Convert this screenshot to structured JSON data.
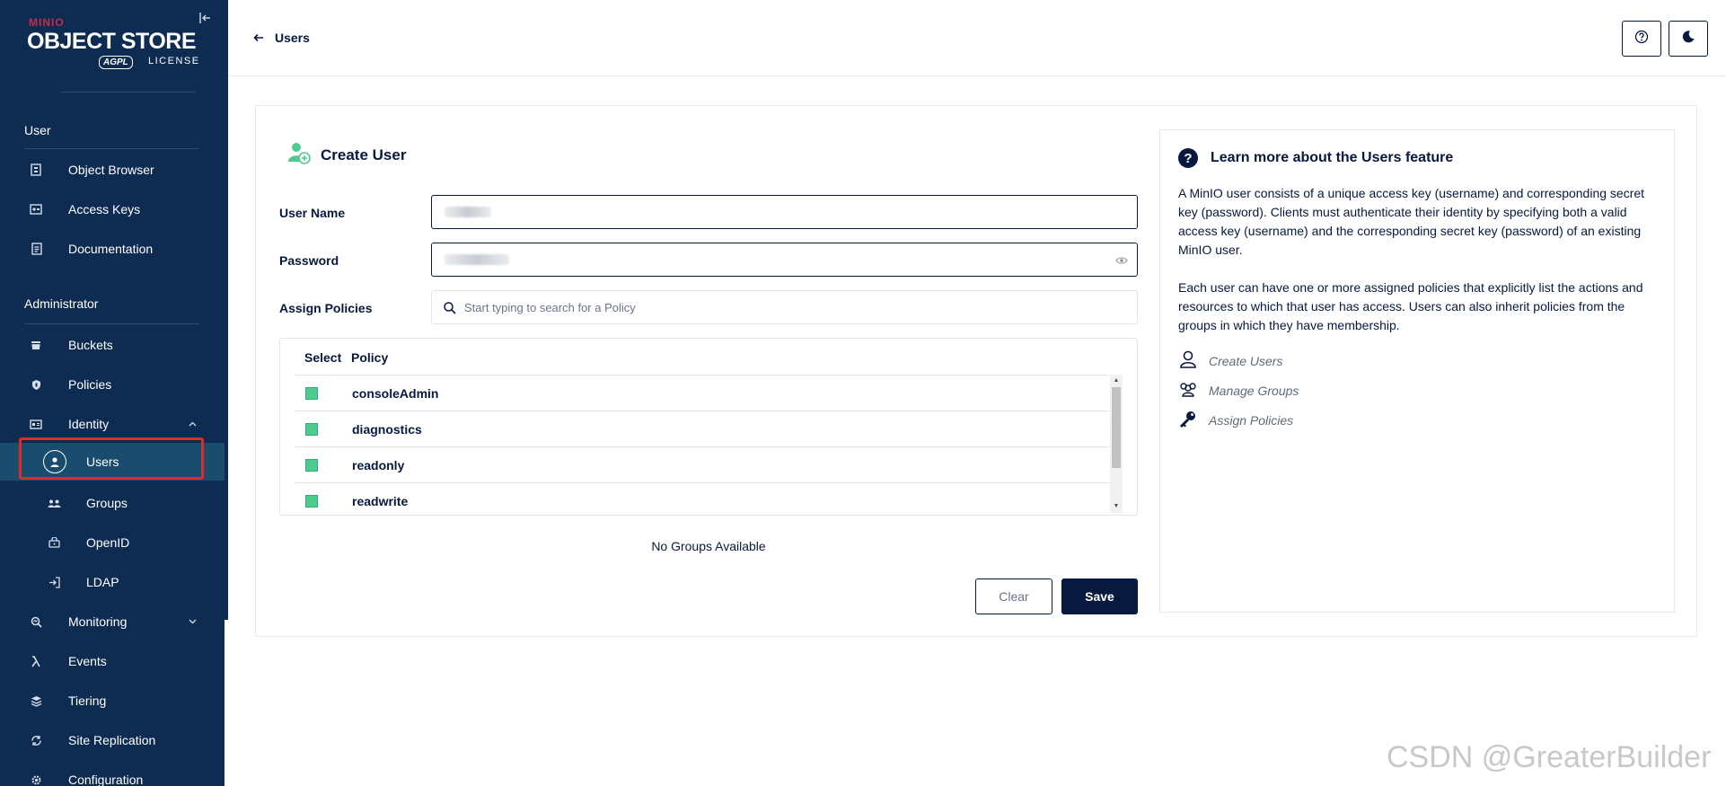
{
  "brand": {
    "minio": "MINIO",
    "title": "OBJECT STORE",
    "agpl": "AGPL",
    "license": "LICENSE"
  },
  "sidebar": {
    "sections": [
      {
        "title": "User",
        "items": [
          {
            "label": "Object Browser",
            "icon": "object-browser-icon"
          },
          {
            "label": "Access Keys",
            "icon": "access-keys-icon"
          },
          {
            "label": "Documentation",
            "icon": "documentation-icon"
          }
        ]
      },
      {
        "title": "Administrator",
        "items": [
          {
            "label": "Buckets",
            "icon": "buckets-icon"
          },
          {
            "label": "Policies",
            "icon": "policies-icon"
          },
          {
            "label": "Identity",
            "icon": "identity-icon",
            "expanded": true,
            "children": [
              {
                "label": "Users",
                "icon": "user-icon",
                "active": true
              },
              {
                "label": "Groups",
                "icon": "groups-icon"
              },
              {
                "label": "OpenID",
                "icon": "openid-icon"
              },
              {
                "label": "LDAP",
                "icon": "ldap-icon"
              }
            ]
          },
          {
            "label": "Monitoring",
            "icon": "monitoring-icon"
          },
          {
            "label": "Events",
            "icon": "lambda-icon"
          },
          {
            "label": "Tiering",
            "icon": "tiering-icon"
          },
          {
            "label": "Site Replication",
            "icon": "site-replication-icon"
          },
          {
            "label": "Configuration",
            "icon": "gear-icon"
          }
        ]
      }
    ]
  },
  "header": {
    "back_label": "Users"
  },
  "form": {
    "title": "Create User",
    "username_label": "User Name",
    "password_label": "Password",
    "policies_label": "Assign Policies",
    "search_placeholder": "Start typing to search for a Policy",
    "table": {
      "col_select": "Select",
      "col_policy": "Policy",
      "rows": [
        "consoleAdmin",
        "diagnostics",
        "readonly",
        "readwrite"
      ]
    },
    "no_groups": "No Groups Available",
    "clear_label": "Clear",
    "save_label": "Save"
  },
  "help": {
    "title": "Learn more about the Users feature",
    "paragraph1": "A MinIO user consists of a unique access key (username) and corresponding secret key (password). Clients must authenticate their identity by specifying both a valid access key (username) and the corresponding secret key (password) of an existing MinIO user.",
    "paragraph2": "Each user can have one or more assigned policies that explicitly list the actions and resources to which that user has access. Users can also inherit policies from the groups in which they have membership.",
    "links": [
      "Create Users",
      "Manage Groups",
      "Assign Policies"
    ]
  },
  "watermark": "CSDN @GreaterBuilder",
  "colors": {
    "sidebar_bg": "#0e2b52",
    "accent": "#07193e",
    "checkbox": "#4ccb8f",
    "highlight": "#e02a2a",
    "brand_red": "#c72c48"
  }
}
